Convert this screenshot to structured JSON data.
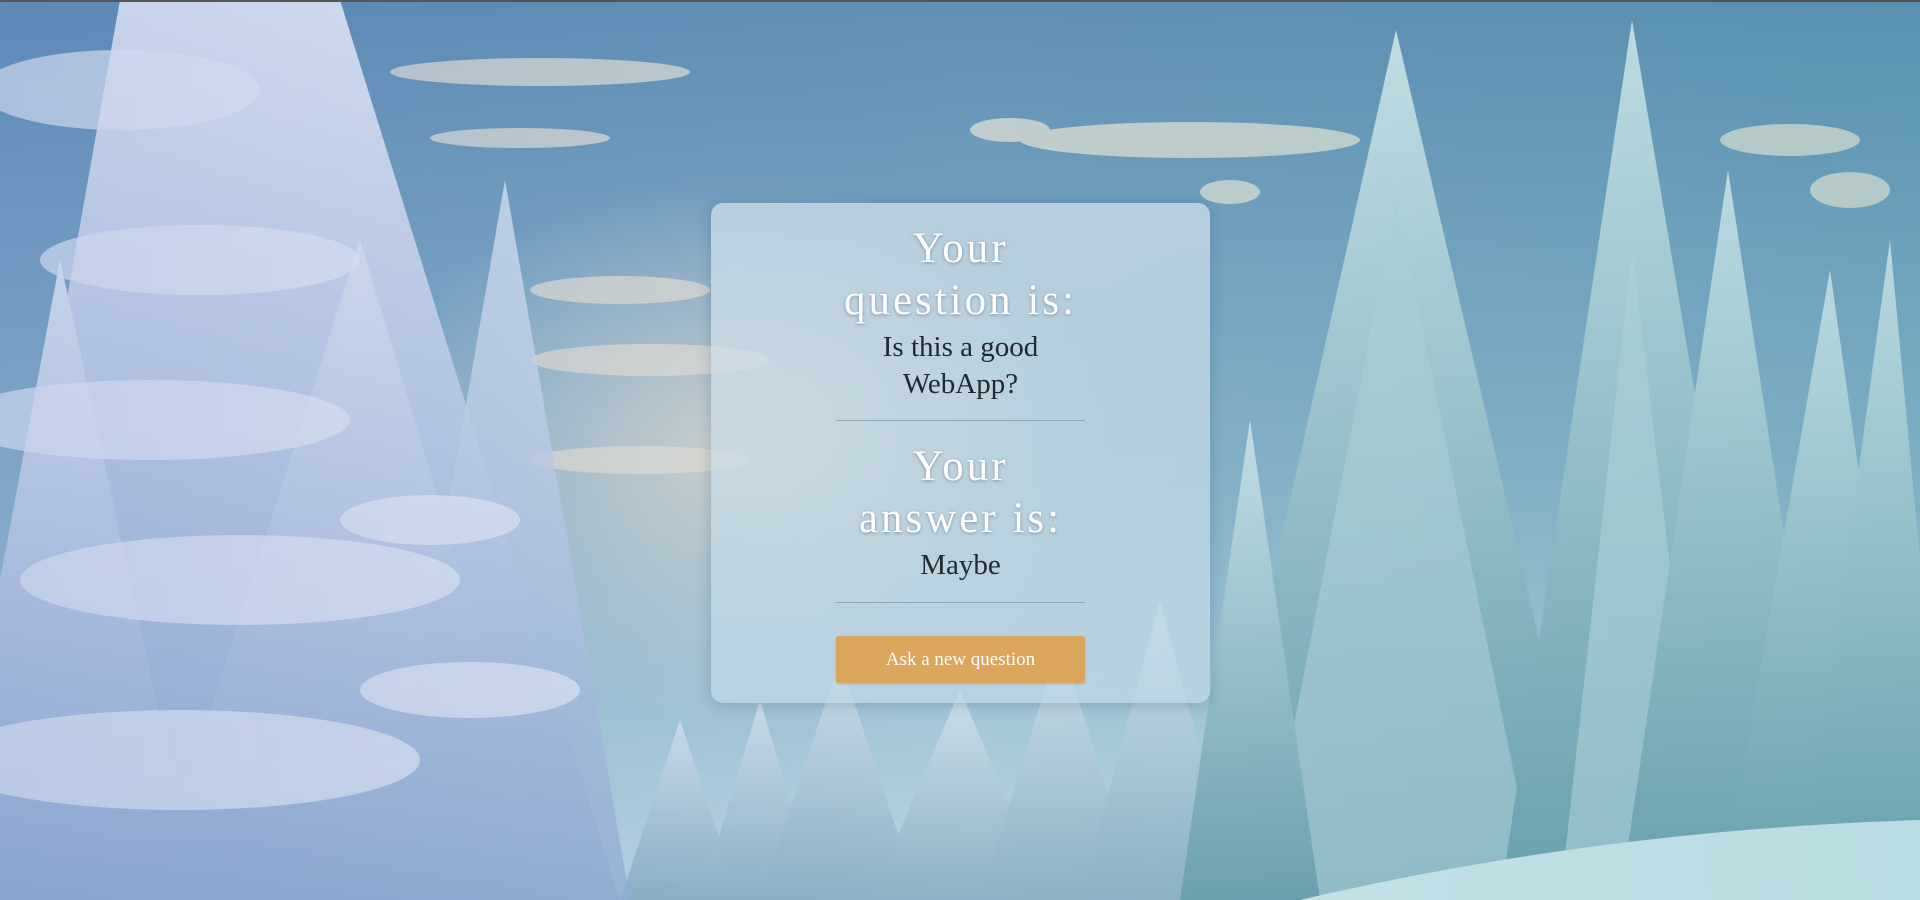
{
  "question_section": {
    "heading_line1": "Your",
    "heading_line2": "question is:",
    "question_line1": "Is this a good",
    "question_line2": "WebApp?"
  },
  "answer_section": {
    "heading_line1": "Your",
    "heading_line2": "answer is:",
    "answer": "Maybe"
  },
  "actions": {
    "new_question_label": "Ask a new question"
  },
  "colors": {
    "button": "#dba55c",
    "heading_text": "#ffffff",
    "value_text": "#222a2f"
  }
}
